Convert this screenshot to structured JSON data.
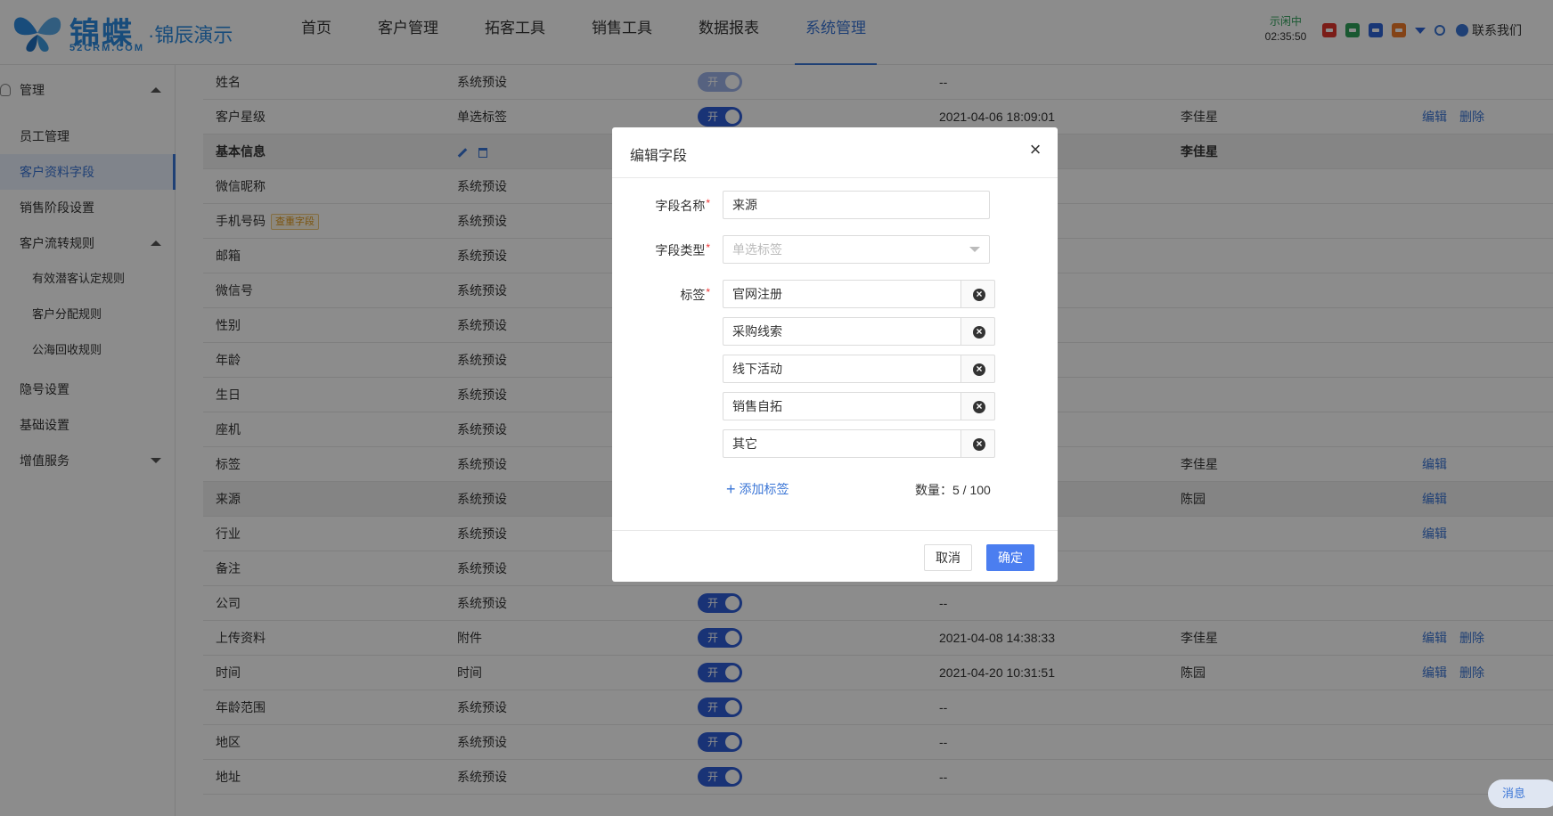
{
  "header": {
    "brand": "锦蝶",
    "brand_sub": "52CRM.COM",
    "product": "·锦辰演示",
    "nav": [
      "首页",
      "客户管理",
      "拓客工具",
      "销售工具",
      "数据报表",
      "系统管理"
    ],
    "active_nav": "系统管理",
    "status": "示闲中",
    "timer": "02:35:50",
    "contact": "联系我们",
    "colors": {
      "accent": "#3a75d6",
      "red": "#e0362c",
      "green": "#2fa05a",
      "blue": "#2f64d8",
      "orange": "#f07b29"
    }
  },
  "sidebar": {
    "group_title": "管理",
    "items": [
      "员工管理",
      "客户资料字段",
      "销售阶段设置",
      "客户流转规则",
      "有效潜客认定规则",
      "客户分配规则",
      "公海回收规则",
      "隐号设置",
      "基础设置",
      "增值服务"
    ],
    "active": "客户资料字段"
  },
  "table": {
    "switch_on": "开",
    "edit": "编辑",
    "delete": "删除",
    "dup_badge": "查重字段",
    "rows": [
      {
        "name": "姓名",
        "type": "系统预设",
        "switch": true,
        "dim": true,
        "time": "--",
        "user": ""
      },
      {
        "name": "客户星级",
        "type": "单选标签",
        "switch": true,
        "time": "2021-04-06 18:09:01",
        "user": "李佳星"
      },
      {
        "name": "基本信息",
        "type": "",
        "switch": false,
        "time": "",
        "user": "李佳星"
      },
      {
        "name": "微信昵称",
        "type": "系统预设"
      },
      {
        "name": "手机号码",
        "type": "系统预设"
      },
      {
        "name": "邮箱",
        "type": "系统预设"
      },
      {
        "name": "微信号",
        "type": "系统预设"
      },
      {
        "name": "性别",
        "type": "系统预设"
      },
      {
        "name": "年龄",
        "type": "系统预设"
      },
      {
        "name": "生日",
        "type": "系统预设"
      },
      {
        "name": "座机",
        "type": "系统预设"
      },
      {
        "name": "标签",
        "type": "系统预设",
        "user": "李佳星"
      },
      {
        "name": "来源",
        "type": "系统预设",
        "user": "陈园"
      },
      {
        "name": "行业",
        "type": "系统预设"
      },
      {
        "name": "备注",
        "type": "系统预设"
      },
      {
        "name": "公司",
        "type": "系统预设",
        "switch": true,
        "time": "--"
      },
      {
        "name": "上传资料",
        "type": "附件",
        "switch": true,
        "time": "2021-04-08 14:38:33",
        "user": "李佳星"
      },
      {
        "name": "时间",
        "type": "时间",
        "switch": true,
        "time": "2021-04-20 10:31:51",
        "user": "陈园"
      },
      {
        "name": "年龄范围",
        "type": "系统预设",
        "switch": true,
        "time": "--"
      },
      {
        "name": "地区",
        "type": "系统预设",
        "switch": true,
        "time": "--"
      },
      {
        "name": "地址",
        "type": "系统预设",
        "switch": true,
        "time": "--"
      }
    ]
  },
  "modal": {
    "title": "编辑字段",
    "field_name_label": "字段名称",
    "field_name_value": "来源",
    "field_type_label": "字段类型",
    "field_type_value": "单选标签",
    "tags_label": "标签",
    "tags": [
      "官网注册",
      "采购线索",
      "线下活动",
      "销售自拓",
      "其它"
    ],
    "add_tag": "添加标签",
    "count": "数量：5 / 100",
    "cancel": "取消",
    "ok": "确定"
  },
  "message_pill": "消息"
}
